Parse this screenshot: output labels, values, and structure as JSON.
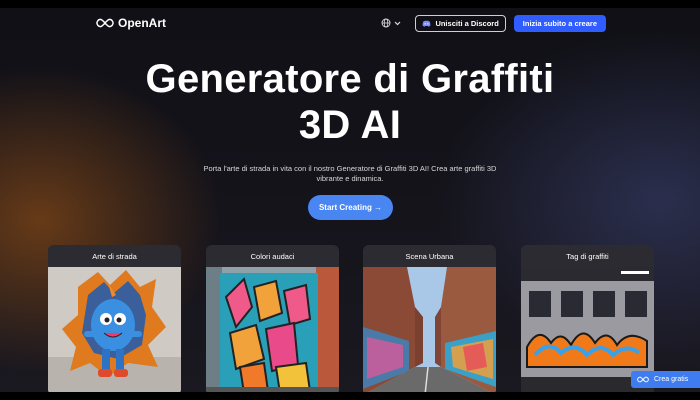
{
  "nav": {
    "logo_text": "OpenArt",
    "language_icon": "globe-icon",
    "discord_label": "Unisciti a Discord",
    "cta_label": "Inizia subito a creare"
  },
  "hero": {
    "title_line1": "Generatore di Graffiti",
    "title_line2": "3D AI",
    "subtitle_line1": "Porta l'arte di strada in vita con il nostro Generatore di Graffiti 3D AI! Crea arte graffiti 3D",
    "subtitle_line2": "vibrante e dinamica.",
    "start_label": "Start Creating →"
  },
  "cards": [
    {
      "label": "Arte di strada",
      "image": "graffiti-monster-illustration"
    },
    {
      "label": "Colori audaci",
      "image": "colorful-graffiti-letters"
    },
    {
      "label": "Scena Urbana",
      "image": "urban-alley-graffiti"
    },
    {
      "label": "Tag di graffiti",
      "image": "subway-train-graffiti"
    }
  ],
  "float": {
    "label": "Crea gratis"
  },
  "colors": {
    "accent": "#2f5dff",
    "start_button": "#4a86f2",
    "background": "#101016"
  }
}
